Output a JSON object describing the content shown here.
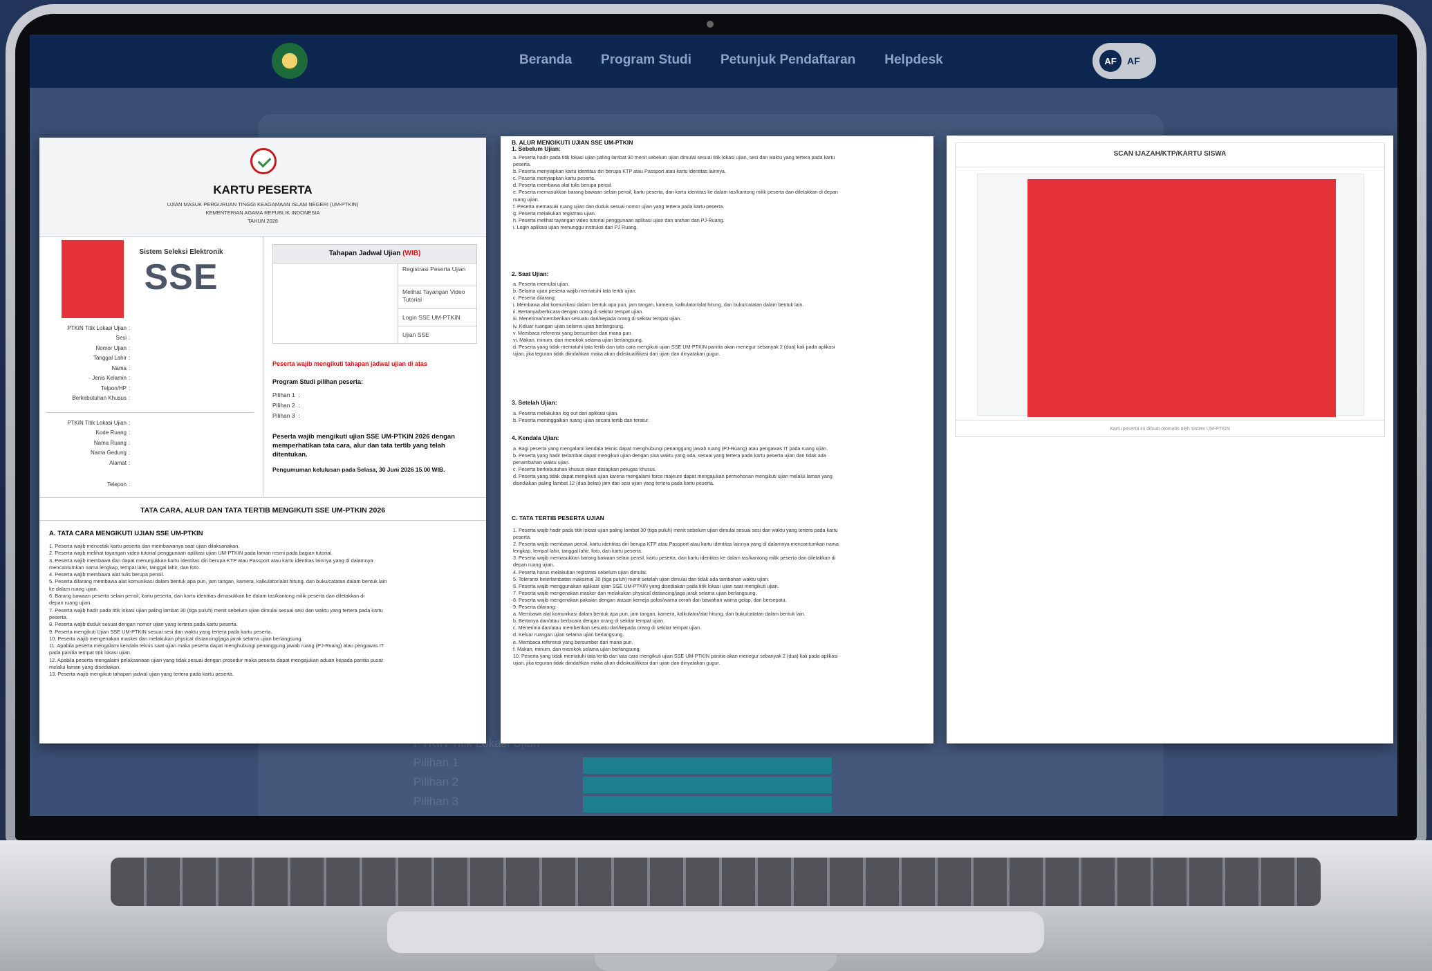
{
  "site": {
    "nav": [
      "Beranda",
      "Program Studi",
      "Petunjuk Pendaftaran",
      "Helpdesk"
    ],
    "avatar_initials": "AF",
    "avatar_text": "AF",
    "bg_labels": [
      "PTKIN Titik Lokasi Ujian",
      "Pilihan 1",
      "Pilihan 2",
      "Pilihan 3"
    ]
  },
  "card": {
    "title": "KARTU PESERTA",
    "subtitle1": "UJIAN MASUK PERGURUAN TINGGI KEAGAMAAN ISLAM NEGERI (UM-PTKIN)",
    "subtitle2": "KEMENTERIAN AGAMA REPUBLIK INDONESIA",
    "subtitle3": "TAHUN 2026",
    "sse_label": "Sistem Seleksi Elektronik",
    "sse": "SSE",
    "fields1": [
      "PTKIN Titik Lokasi Ujian",
      "Sesi",
      "Nomor Ujian",
      "Tanggal Lahir",
      "Nama",
      "Jenis Kelamin",
      "Telpon/HP",
      "Berkebutuhan Khusus"
    ],
    "fields2": [
      "PTKIN Titik Lokasi Ujian",
      "Kode Ruang",
      "Nama Ruang",
      "Nama Gedung",
      "Alamat"
    ],
    "field_phone": "Telepon",
    "schedule_title": "Tahapan Jadwal Ujian",
    "schedule_tz": "(WIB)",
    "schedule_steps": [
      "Registrasi Peserta Ujian",
      "Melihat Tayangan Video Tutorial",
      "Login SSE UM-PTKIN",
      "Ujian SSE"
    ],
    "warning": "Peserta wajib mengikuti tahapan jadwal ujian di atas",
    "program_title": "Program Studi pilihan peserta:",
    "pilihan": [
      "Pilihan 1",
      "Pilihan 2",
      "Pilihan 3"
    ],
    "note": "Peserta wajib mengikuti ujian SSE UM-PTKIN 2026 dengan memperhatikan tata cara, alur dan tata tertib yang telah ditentukan.",
    "announcement": "Pengumuman kelulusan pada Selasa, 30 Juni 2026 15.00 WIB.",
    "tata_title": "TATA CARA, ALUR DAN TATA TERTIB MENGIKUTI SSE UM-PTKIN 2026",
    "sectionA": "A. TATA CARA MENGIKUTI UJIAN SSE UM-PTKIN",
    "sectionA_items": [
      "1. Peserta wajib mencetak kartu peserta dan membawanya saat ujian dilaksanakan.",
      "2. Peserta wajib melihat tayangan video tutorial penggunaan aplikasi ujian UM-PTKIN pada laman resmi pada bagian tutorial.",
      "3. Peserta wajib membawa dan dapat menunjukkan kartu identitas diri berupa KTP atau Passport atau kartu identitas lainnya yang di dalamnya",
      "    mencantumkan nama lengkap, tempat lahir, tanggal lahir, dan foto.",
      "4. Peserta wajib membawa alat tulis berupa pensil.",
      "5. Peserta dilarang membawa alat komunikasi dalam bentuk apa pun, jam tangan, kamera, kalkulator/alat hitung, dan buku/catatan dalam bentuk lain",
      "    ke dalam ruang ujian.",
      "6. Barang bawaan peserta selain pensil, kartu peserta, dan kartu identitas dimasukkan ke dalam tas/kantong milik peserta dan diletakkan di",
      "    depan ruang ujian.",
      "7. Peserta wajib hadir pada titik lokasi ujian paling lambat 30 (tiga puluh) menit sebelum ujian dimulai sesuai sesi dan waktu yang tertera pada kartu",
      "    peserta.",
      "8. Peserta wajib duduk sesuai dengan nomor ujian yang tertera pada kartu peserta.",
      "9. Peserta mengikuti Ujian SSE UM-PTKIN sesuai sesi dan waktu yang tertera pada kartu peserta.",
      "10. Peserta wajib mengenakan masker dan melakukan physical distancing/jaga jarak selama ujian berlangsung.",
      "11. Apabila peserta mengalami kendala teknis saat ujian maka peserta dapat menghubungi penanggung jawab ruang (PJ-Ruang) atau pengawas IT",
      "    pada panitia tempat titik lokasi ujian.",
      "12. Apabila peserta mengalami pelaksanaan ujian yang tidak sesuai dengan prosedur maka peserta dapat mengajukan aduan kepada panitia pusat",
      "    melalui laman yang disediakan.",
      "13. Peserta wajib mengikuti tahapan jadwal ujian yang tertera pada kartu peserta."
    ]
  },
  "rules": {
    "sectionB": "B. ALUR MENGIKUTI UJIAN SSE UM-PTKIN",
    "b1": "1. Sebelum Ujian:",
    "b1_items": [
      "a. Peserta hadir pada titik lokasi ujian paling lambat 30 menit sebelum ujian dimulai sesuai titik lokasi ujian, sesi dan waktu yang tertera pada kartu",
      "    peserta.",
      "b. Peserta menyiapkan kartu identitas diri berupa KTP atau Passport atau kartu identitas lainnya.",
      "c. Peserta menyiapkan kartu peserta.",
      "d. Peserta membawa alat tulis berupa pensil.",
      "e. Peserta memasukkan barang bawaan selain pensil, kartu peserta, dan kartu identitas ke dalam tas/kantong milik peserta dan diletakkan di depan",
      "    ruang ujian.",
      "f. Peserta memasuki ruang ujian dan duduk sesuai nomor ujian yang tertera pada kartu peserta.",
      "g. Peserta melakukan registrasi ujian.",
      "h. Peserta melihat tayangan video tutorial penggunaan aplikasi ujian dan arahan dari PJ-Ruang.",
      "i. Login aplikasi ujian menunggu instruksi dari PJ Ruang."
    ],
    "b2": "2. Saat Ujian:",
    "b2_items": [
      "a. Peserta memulai ujian.",
      "b. Selama ujian peserta wajib mematuhi tata tertib ujian.",
      "c. Peserta dilarang:",
      "     i. Membawa alat komunikasi dalam bentuk apa pun, jam tangan, kamera, kalkulator/alat hitung, dan buku/catatan dalam bentuk lain.",
      "     ii. Bertanya/berbicara dengan orang di sekitar tempat ujian.",
      "     iii. Menerima/memberikan sesuatu dari/kepada orang di sekitar tempat ujian.",
      "     iv. Keluar ruangan ujian selama ujian berlangsung.",
      "     v. Membaca referensi yang bersumber dari mana pun.",
      "     vi. Makan, minum, dan merokok selama ujian berlangsung.",
      "d. Peserta yang tidak mematuhi tata tertib dan tata cara mengikuti ujian SSE UM-PTKIN panitia akan menegur sebanyak 2 (dua) kali pada aplikasi",
      "    ujian, jika teguran tidak diindahkan maka akan didiskualifikasi dari ujian dan dinyatakan gugur."
    ],
    "b3": "3. Setelah Ujian:",
    "b3_items": [
      "a. Peserta melakukan log out dari aplikasi ujian.",
      "b. Peserta meninggalkan ruang ujian secara tertib dan teratur."
    ],
    "b4": "4. Kendala Ujian:",
    "b4_items": [
      "a. Bagi peserta yang mengalami kendala teknis dapat menghubungi penanggung jawab ruang (PJ-Ruang) atau pengawas IT pada ruang ujian.",
      "b. Peserta yang hadir terlambat dapat mengikuti ujian dengan sisa waktu yang ada, sesuai yang tertera pada kartu peserta ujian dan tidak ada",
      "    penambahan waktu ujian.",
      "c. Peserta berkebutuhan khusus akan disiapkan petugas khusus.",
      "d. Peserta yang tidak dapat mengikuti ujian karena mengalami force majeure dapat mengajukan permohonan mengikuti ujian melalui laman yang",
      "    disediakan paling lambat 12 (dua belas) jam dari sesi ujian yang tertera pada kartu peserta."
    ],
    "sectionC": "C. TATA TERTIB PESERTA UJIAN",
    "c_items": [
      "1. Peserta wajib hadir pada titik lokasi ujian paling lambat 30 (tiga puluh) menit sebelum ujian dimulai sesuai sesi dan waktu yang tertera pada kartu",
      "    peserta.",
      "2. Peserta wajib membawa pensil, kartu identitas diri berupa KTP atau Passport atau kartu identitas lainnya yang di dalamnya mencantumkan nama",
      "    lengkap, tempat lahir, tanggal lahir, foto, dan kartu peserta.",
      "3. Peserta wajib memasukkan barang bawaan selain pensil, kartu peserta, dan kartu identitas ke dalam tas/kantong milik peserta dan diletakkan di",
      "    depan ruang ujian.",
      "4. Peserta harus melakukan registrasi sebelum ujian dimulai.",
      "5. Toleransi keterlambatan maksimal 30 (tiga puluh) menit setelah ujian dimulai dan tidak ada tambahan waktu ujian.",
      "6. Peserta wajib menggunakan aplikasi ujian SSE UM-PTKIN yang disediakan pada titik lokasi ujian saat mengikuti ujian.",
      "7. Peserta wajib mengenakan masker dan melakukan physical distancing/jaga jarak selama ujian berlangsung.",
      "8. Peserta wajib mengenakan pakaian dengan atasan kemeja polos/warna cerah dan bawahan warna gelap, dan bersepatu.",
      "9. Peserta dilarang:",
      "     a. Membawa alat komunikasi dalam bentuk apa pun, jam tangan, kamera, kalkulator/alat hitung, dan buku/catatan dalam bentuk lain.",
      "     b. Bertanya dan/atau berbicara dengan orang di sekitar tempat ujian.",
      "     c. Menerima dan/atau memberikan sesuatu dari/kepada orang di sekitar tempat ujian.",
      "     d. Keluar ruangan ujian selama ujian berlangsung.",
      "     e. Membaca referensi yang bersumber dari mana pun.",
      "     f. Makan, minum, dan merokok selama ujian berlangsung.",
      "10. Peserta yang tidak mematuhi tata tertib dan tata cara mengikuti ujian SSE UM-PTKIN panitia akan menegur sebanyak 2 (dua) kali pada aplikasi",
      "    ujian, jika teguran tidak diindahkan maka akan didiskualifikasi dari ujian dan dinyatakan gugur."
    ]
  },
  "scan": {
    "title": "SCAN IJAZAH/KTP/KARTU SISWA",
    "caption": "Kartu peserta ini dibuat otomatis oleh sistem UM-PTKIN"
  },
  "colors": {
    "nav_bg": "#0e2750",
    "photo_red": "#e53239",
    "warn_red": "#d11111"
  }
}
